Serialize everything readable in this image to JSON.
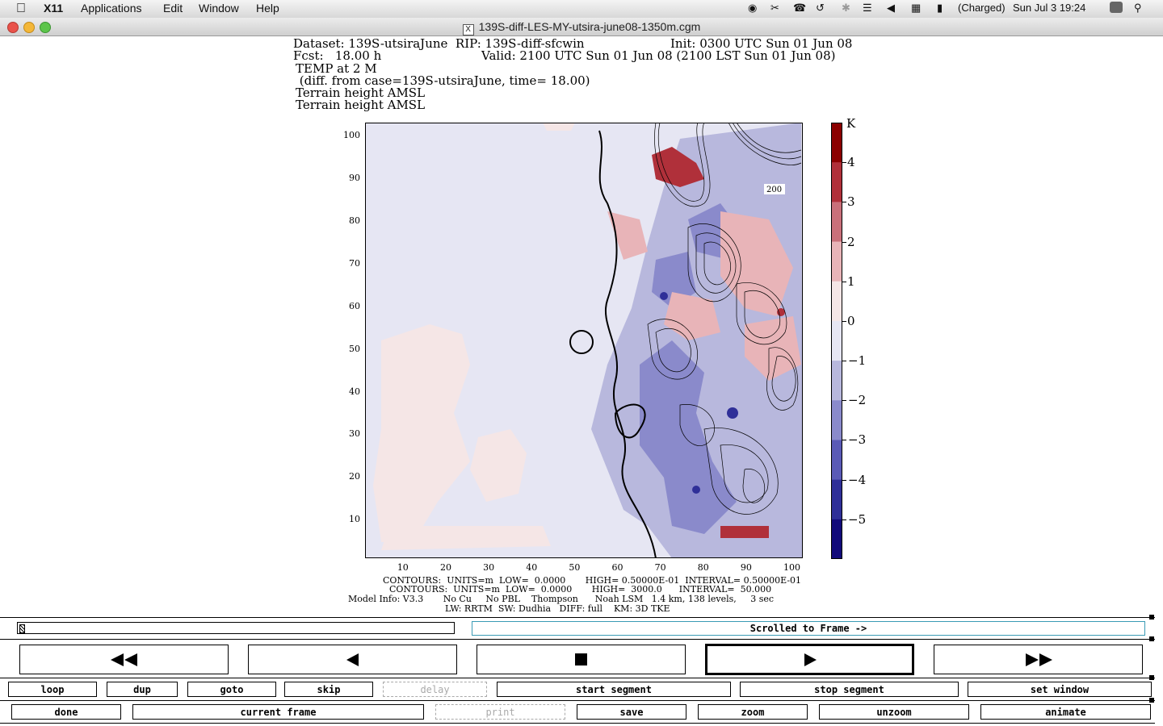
{
  "menubar": {
    "app": "X11",
    "items": [
      "Applications",
      "Edit",
      "Window",
      "Help"
    ],
    "battery": "(Charged)",
    "clock": "Sun Jul 3  19:24"
  },
  "window": {
    "title": "139S-diff-LES-MY-utsira-june08-1350m.cgm"
  },
  "plot": {
    "header": {
      "line1a": "Dataset: 139S-utsiraJune  RIP: 139S-diff-sfcwin",
      "line1b": "Init: 0300 UTC Sun 01 Jun 08",
      "line2a": "Fcst:   18.00 h",
      "line2b": "Valid: 2100 UTC Sun 01 Jun 08 (2100 LST Sun 01 Jun 08)",
      "line3": "TEMP at 2 M",
      "line4": " (diff. from case=139S-utsiraJune, time= 18.00)",
      "line5": "Terrain height AMSL",
      "line6": "Terrain height AMSL"
    },
    "contour_label": "200",
    "footer": {
      "f1": "CONTOURS:  UNITS=m  LOW=  0.0000       HIGH= 0.50000E-01  INTERVAL= 0.50000E-01",
      "f2": "CONTOURS:  UNITS=m  LOW=  0.0000       HIGH=  3000.0      INTERVAL=  50.000",
      "f3": "Model Info: V3.3       No Cu     No PBL    Thompson      Noah LSM   1.4 km, 138 levels,     3 sec",
      "f4": "LW: RRTM  SW: Dudhia   DIFF: full    KM: 3D TKE"
    }
  },
  "chart_data": {
    "type": "heatmap",
    "title": "TEMP at 2 M",
    "x_ticks": [
      10,
      20,
      30,
      40,
      50,
      60,
      70,
      80,
      90,
      100
    ],
    "y_ticks": [
      10,
      20,
      30,
      40,
      50,
      60,
      70,
      80,
      90,
      100
    ],
    "xlim": [
      1,
      103
    ],
    "ylim": [
      1,
      103
    ],
    "colorbar": {
      "unit": "K",
      "labels": [
        "4",
        "3",
        "2",
        "1",
        "0",
        "−1",
        "−2",
        "−3",
        "−4",
        "−5"
      ],
      "bands": [
        {
          "range": [
            4,
            5
          ],
          "color": "#8b0000"
        },
        {
          "range": [
            3,
            4
          ],
          "color": "#b0303a"
        },
        {
          "range": [
            2,
            3
          ],
          "color": "#c9707a"
        },
        {
          "range": [
            1,
            2
          ],
          "color": "#e8b4b8"
        },
        {
          "range": [
            0,
            1
          ],
          "color": "#f5e6e6"
        },
        {
          "range": [
            -1,
            0
          ],
          "color": "#e6e6f3"
        },
        {
          "range": [
            -2,
            -1
          ],
          "color": "#b8b8dd"
        },
        {
          "range": [
            -3,
            -2
          ],
          "color": "#8a8acb"
        },
        {
          "range": [
            -4,
            -3
          ],
          "color": "#5a5ab6"
        },
        {
          "range": [
            -5,
            -4
          ],
          "color": "#2f2f98"
        },
        {
          "range": [
            -6,
            -5
          ],
          "color": "#120a7a"
        }
      ]
    }
  },
  "controls": {
    "status": "Scrolled to Frame ->",
    "row1": [
      "loop",
      "dup",
      "goto",
      "skip",
      "delay",
      "start segment",
      "stop segment",
      "set window"
    ],
    "row2": [
      "done",
      "current frame",
      "print",
      "save",
      "zoom",
      "unzoom",
      "animate"
    ]
  }
}
